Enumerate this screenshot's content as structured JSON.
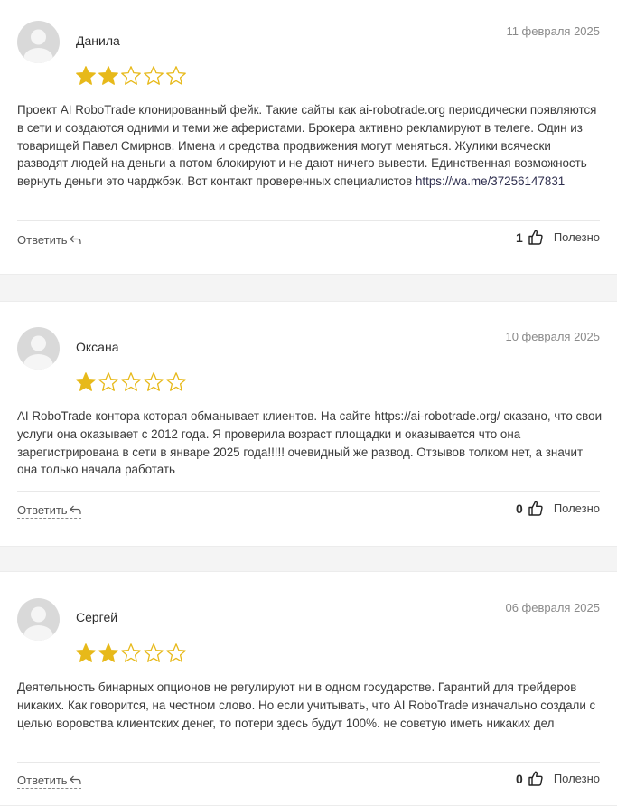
{
  "reviews": [
    {
      "author": "Данила",
      "date": "11 февраля 2025",
      "rating": 2,
      "max_rating": 5,
      "text": "Проект AI RoboTrade клонированный фейк. Такие сайты как ai-robotrade.org периодически появляются в сети и создаются одними и теми же аферистами. Брокера активно рекламируют в телеге. Один из товарищей Павел Смирнов. Имена и средства продвижения могут меняться. Жулики всячески разводят людей на деньги а потом блокируют и не дают ничего вывести. Единственная возможность вернуть деньги это чарджбэк. Вот контакт проверенных специалистов ",
      "link": "https://wa.me/37256147831",
      "reply_label": "Ответить",
      "helpful_count": "1",
      "helpful_label": "Полезно"
    },
    {
      "author": "Оксана",
      "date": "10 февраля 2025",
      "rating": 1,
      "max_rating": 5,
      "text": "AI RoboTrade контора которая обманывает клиентов. На сайте https://ai-robotrade.org/ сказано, что свои услуги она оказывает с 2012 года. Я проверила возраст площадки и оказывается что она зарегистрирована в сети в январе 2025 года!!!!! очевидный же развод. Отзывов толком нет, а значит она только начала работать",
      "reply_label": "Ответить",
      "helpful_count": "0",
      "helpful_label": "Полезно"
    },
    {
      "author": "Сергей",
      "date": "06 февраля 2025",
      "rating": 2,
      "max_rating": 5,
      "text": "Деятельность бинарных опционов не регулируют ни в одном государстве. Гарантий для трейдеров никаких. Как говорится, на честном слово. Но если учитывать, что AI RoboTrade изначально создали с целью воровства клиентских денег, то потери здесь будут 100%. не советую иметь никаких дел",
      "reply_label": "Ответить",
      "helpful_count": "0",
      "helpful_label": "Полезно"
    }
  ],
  "colors": {
    "star": "#e7b91a",
    "accent": "#2f2f4f"
  },
  "icons": {
    "avatar": "user-silhouette",
    "reply": "reply-arrow-icon",
    "helpful": "thumbs-up-icon",
    "star": "star-icon"
  }
}
